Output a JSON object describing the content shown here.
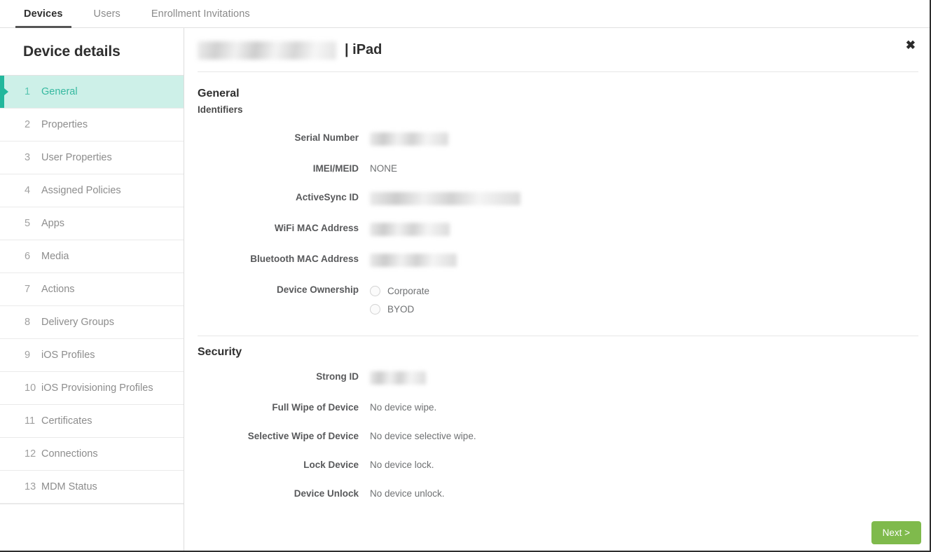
{
  "tabs": [
    {
      "label": "Devices",
      "active": true
    },
    {
      "label": "Users",
      "active": false
    },
    {
      "label": "Enrollment Invitations",
      "active": false
    }
  ],
  "sidebar": {
    "title": "Device details",
    "items": [
      {
        "num": "1",
        "label": "General",
        "active": true
      },
      {
        "num": "2",
        "label": "Properties",
        "active": false
      },
      {
        "num": "3",
        "label": "User Properties",
        "active": false
      },
      {
        "num": "4",
        "label": "Assigned Policies",
        "active": false
      },
      {
        "num": "5",
        "label": "Apps",
        "active": false
      },
      {
        "num": "6",
        "label": "Media",
        "active": false
      },
      {
        "num": "7",
        "label": "Actions",
        "active": false
      },
      {
        "num": "8",
        "label": "Delivery Groups",
        "active": false
      },
      {
        "num": "9",
        "label": "iOS Profiles",
        "active": false
      },
      {
        "num": "10",
        "label": "iOS Provisioning Profiles",
        "active": false
      },
      {
        "num": "11",
        "label": "Certificates",
        "active": false
      },
      {
        "num": "12",
        "label": "Connections",
        "active": false
      },
      {
        "num": "13",
        "label": "MDM Status",
        "active": false
      }
    ]
  },
  "device_header": {
    "name_redacted": "",
    "device_type": "| iPad",
    "close_label": "✖"
  },
  "general": {
    "section_title": "General",
    "identifiers_title": "Identifiers",
    "fields": [
      {
        "label": "Serial Number",
        "value": "",
        "redacted": true
      },
      {
        "label": "IMEI/MEID",
        "value": "NONE",
        "redacted": false
      },
      {
        "label": "ActiveSync ID",
        "value": "",
        "redacted": true
      },
      {
        "label": "WiFi MAC Address",
        "value": "",
        "redacted": true
      },
      {
        "label": "Bluetooth MAC Address",
        "value": "",
        "redacted": true
      }
    ],
    "ownership": {
      "label": "Device Ownership",
      "options": [
        {
          "label": "Corporate",
          "selected": false
        },
        {
          "label": "BYOD",
          "selected": false
        }
      ]
    }
  },
  "security": {
    "section_title": "Security",
    "fields": [
      {
        "label": "Strong ID",
        "value": "",
        "redacted": true
      },
      {
        "label": "Full Wipe of Device",
        "value": "No device wipe.",
        "redacted": false
      },
      {
        "label": "Selective Wipe of Device",
        "value": "No device selective wipe.",
        "redacted": false
      },
      {
        "label": "Lock Device",
        "value": "No device lock.",
        "redacted": false
      },
      {
        "label": "Device Unlock",
        "value": "No device unlock.",
        "redacted": false
      }
    ]
  },
  "footer": {
    "next_label": "Next >"
  },
  "colors": {
    "accent_teal": "#22b79c",
    "active_bg": "#cdf0e8",
    "next_green": "#7fba4c",
    "tab_underline": "#555555"
  }
}
